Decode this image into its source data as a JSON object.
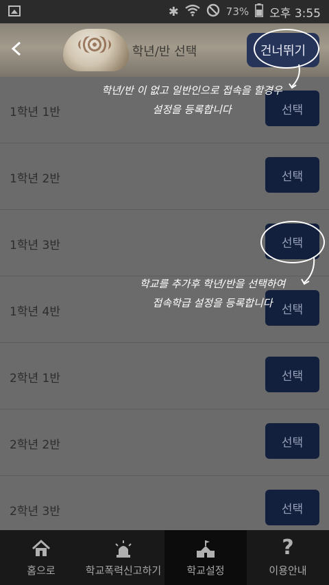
{
  "status_bar": {
    "battery": "73%",
    "time": "오후 3:55"
  },
  "header": {
    "title": "학년/반 선택",
    "skip_label": "건너뛰기"
  },
  "rows": [
    {
      "label": "1학년 1반",
      "button": "선택"
    },
    {
      "label": "1학년 2반",
      "button": "선택"
    },
    {
      "label": "1학년 3반",
      "button": "선택"
    },
    {
      "label": "1학년 4반",
      "button": "선택"
    },
    {
      "label": "2학년 1반",
      "button": "선택"
    },
    {
      "label": "2학년 2반",
      "button": "선택"
    },
    {
      "label": "2학년 3반",
      "button": "선택"
    }
  ],
  "annotations": {
    "skip_note_line1": "학년/반 이 없고 일반인으로 접속을 할경우",
    "skip_note_line2": "설정을 등록합니다",
    "select_note_line1": "학교를 추가후 학년/반을 선택하여",
    "select_note_line2": "접속학급 설정을 등록합니다"
  },
  "bottom_nav": [
    {
      "label": "홈으로",
      "icon": "home-icon"
    },
    {
      "label": "학교폭력신고하기",
      "icon": "siren-icon"
    },
    {
      "label": "학교설정",
      "icon": "school-icon",
      "active": true
    },
    {
      "label": "이용안내",
      "icon": "help-icon"
    }
  ]
}
